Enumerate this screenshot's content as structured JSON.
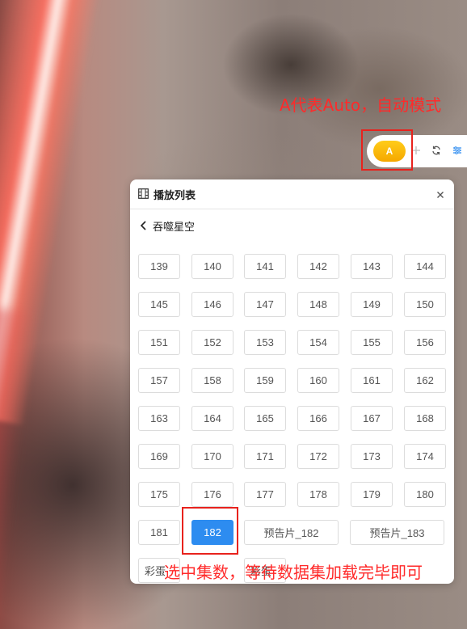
{
  "annotations": {
    "top": "A代表Auto，自动模式",
    "bottom": "选中集数，等待数据集加载完毕即可"
  },
  "controls": {
    "auto_label": "A"
  },
  "panel": {
    "title": "播放列表",
    "series_name": "吞噬星空",
    "episodes": [
      "139",
      "140",
      "141",
      "142",
      "143",
      "144",
      "145",
      "146",
      "147",
      "148",
      "149",
      "150",
      "151",
      "152",
      "153",
      "154",
      "155",
      "156",
      "157",
      "158",
      "159",
      "160",
      "161",
      "162",
      "163",
      "164",
      "165",
      "166",
      "167",
      "168",
      "169",
      "170",
      "171",
      "172",
      "173",
      "174",
      "175",
      "176",
      "177",
      "178",
      "179",
      "180",
      "181",
      "182"
    ],
    "selected_episode": "182",
    "previews": [
      "预告片_182",
      "预告片_183"
    ],
    "extras": [
      "彩蛋",
      "彩蛋"
    ]
  },
  "colors": {
    "accent": "#2d8cf0",
    "annotation": "#ff2a2a",
    "auto_button": "#f5a800"
  }
}
